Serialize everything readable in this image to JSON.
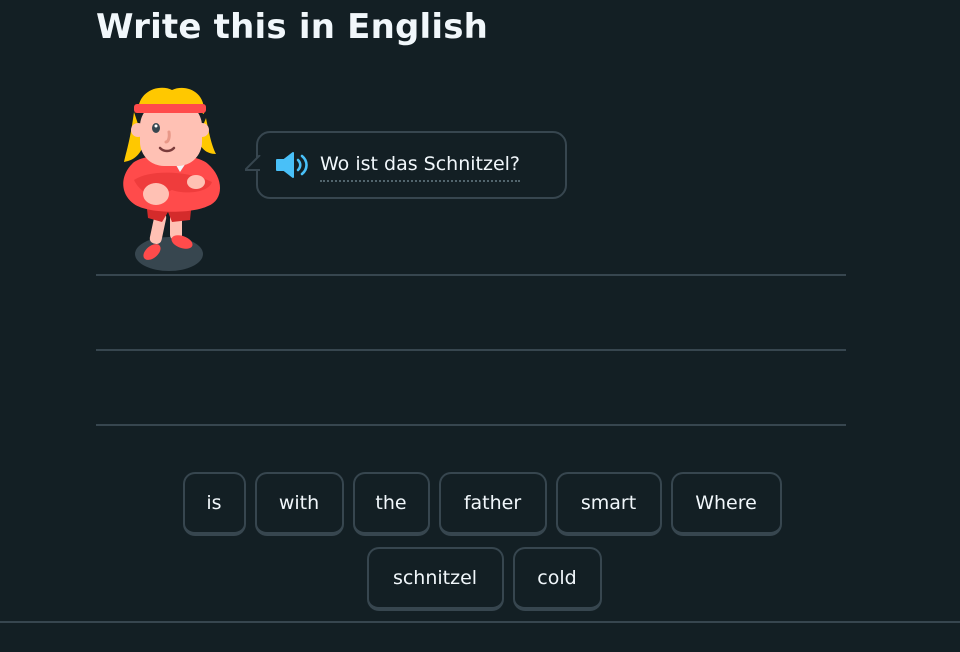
{
  "exercise": {
    "title": "Write this in English",
    "prompt_text": "Wo ist das Schnitzel?",
    "speaker_icon": "speaker-icon",
    "character_icon": "character-illustration"
  },
  "word_bank": {
    "row1": [
      "is",
      "with",
      "the",
      "father",
      "smart",
      "Where"
    ],
    "row2": [
      "schnitzel",
      "cold"
    ]
  },
  "colors": {
    "background": "#131f24",
    "border": "#37464f",
    "text": "#f1f7fb",
    "speaker_blue": "#49c0f8"
  }
}
